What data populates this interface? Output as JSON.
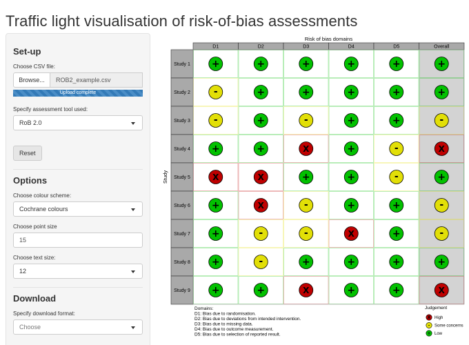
{
  "app_title": "Traffic light visualisation of risk-of-bias assessments",
  "sidebar": {
    "setup_heading": "Set-up",
    "csv_label": "Choose CSV file:",
    "browse_label": "Browse...",
    "file_name": "ROB2_example.csv",
    "progress_text": "Upload complete",
    "progress_value": 1.0,
    "tool_label": "Specify assessment tool used:",
    "tool_value": "RoB 2.0",
    "reset_label": "Reset",
    "options_heading": "Options",
    "colour_label": "Choose colour scheme:",
    "colour_value": "Cochrane colours",
    "point_label": "Choose point size",
    "point_value": "15",
    "text_label": "Choose text size:",
    "text_value": "12",
    "download_heading": "Download",
    "format_label": "Specify download format:",
    "format_placeholder": "Choose"
  },
  "chart_data": {
    "type": "table",
    "top_label": "Risk of bias domains",
    "y_axis_label": "Study",
    "columns": [
      "D1",
      "D2",
      "D3",
      "D4",
      "D5",
      "Overall"
    ],
    "studies": [
      "Study 1",
      "Study 2",
      "Study 3",
      "Study 4",
      "Study 5",
      "Study 6",
      "Study 7",
      "Study 8",
      "Study 9"
    ],
    "judgements": [
      [
        "low",
        "low",
        "low",
        "low",
        "low",
        "low"
      ],
      [
        "some",
        "low",
        "low",
        "low",
        "low",
        "low"
      ],
      [
        "some",
        "low",
        "some",
        "low",
        "low",
        "some"
      ],
      [
        "low",
        "low",
        "high",
        "low",
        "some",
        "high"
      ],
      [
        "high",
        "high",
        "low",
        "low",
        "some",
        "low"
      ],
      [
        "low",
        "high",
        "some",
        "low",
        "low",
        "some"
      ],
      [
        "low",
        "some",
        "some",
        "high",
        "low",
        "some"
      ],
      [
        "low",
        "some",
        "low",
        "low",
        "low",
        "low"
      ],
      [
        "low",
        "low",
        "high",
        "low",
        "low",
        "high"
      ]
    ],
    "symbols": {
      "low": "+",
      "some": "-",
      "high": "X"
    },
    "colors": {
      "low": "#02C100",
      "some": "#E2DF07",
      "high": "#BF0000",
      "header": "#a9a9a9",
      "overall_bg": "#d3d3d3"
    },
    "domains_title": "Domains:",
    "domains": [
      "D1: Bias due to randomisation.",
      "D2: Bias due to deviations from intended intervention.",
      "D3: Bias due to missing data.",
      "D4: Bias due to outcome measurement.",
      "D5: Bias due to selection of reported result."
    ],
    "legend_title": "Judgement",
    "legend": [
      {
        "key": "high",
        "label": "High"
      },
      {
        "key": "some",
        "label": "Some concerns"
      },
      {
        "key": "low",
        "label": "Low"
      }
    ]
  }
}
